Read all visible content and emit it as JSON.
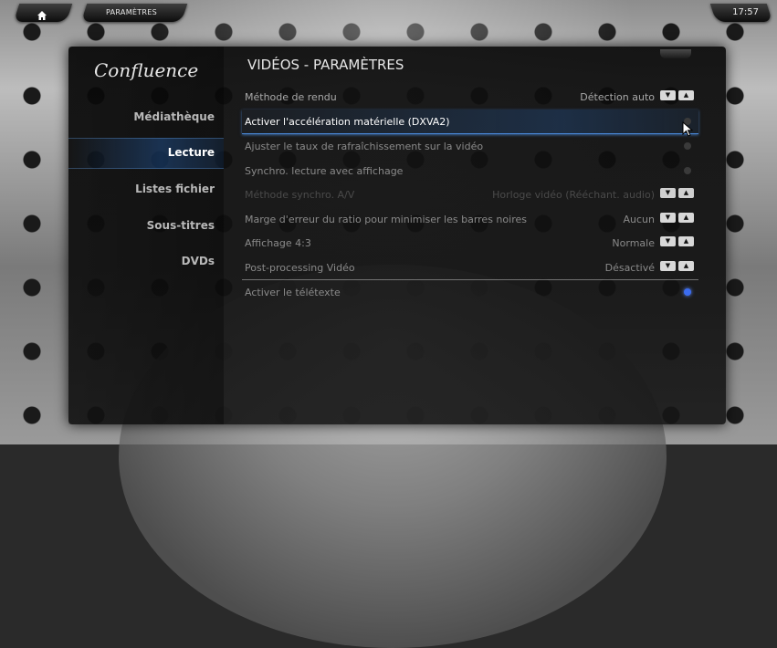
{
  "header": {
    "breadcrumb": "PARAMÈTRES",
    "clock": "17:57"
  },
  "sidebar": {
    "logo": "Confluence",
    "items": [
      {
        "label": "Médiathèque",
        "active": false
      },
      {
        "label": "Lecture",
        "active": true
      },
      {
        "label": "Listes fichier",
        "active": false
      },
      {
        "label": "Sous-titres",
        "active": false
      },
      {
        "label": "DVDs",
        "active": false
      }
    ]
  },
  "main": {
    "title": "VIDÉOS - PARAMÈTRES",
    "settings": [
      {
        "label": "Méthode de rendu",
        "value": "Détection auto",
        "control": "spin",
        "state": "normal"
      },
      {
        "label": "Activer l'accélération matérielle (DXVA2)",
        "value": "",
        "control": "radio",
        "on": false,
        "state": "selected"
      },
      {
        "label": "Ajuster le taux de rafraîchissement sur la vidéo",
        "value": "",
        "control": "radio",
        "on": false,
        "state": "normal"
      },
      {
        "label": "Synchro. lecture avec affichage",
        "value": "",
        "control": "radio",
        "on": false,
        "state": "normal"
      },
      {
        "label": "Méthode synchro. A/V",
        "value": "Horloge vidéo (Rééchant. audio)",
        "control": "spin",
        "state": "disabled"
      },
      {
        "label": "Marge d'erreur du ratio pour minimiser les barres noires",
        "value": "Aucun",
        "control": "spin",
        "state": "normal"
      },
      {
        "label": "Affichage 4:3",
        "value": "Normale",
        "control": "spin",
        "state": "normal"
      },
      {
        "label": "Post-processing Vidéo",
        "value": "Désactivé",
        "control": "spin",
        "state": "normal"
      },
      {
        "label": "Activer le télétexte",
        "value": "",
        "control": "radio",
        "on": true,
        "state": "normal"
      }
    ]
  },
  "colors": {
    "accent": "#3b6cf0",
    "selection": "#5096f0"
  },
  "icons": {
    "home": "home-icon",
    "spin_down": "arrow-down-icon",
    "spin_up": "arrow-up-icon",
    "cursor": "mouse-pointer-icon"
  }
}
